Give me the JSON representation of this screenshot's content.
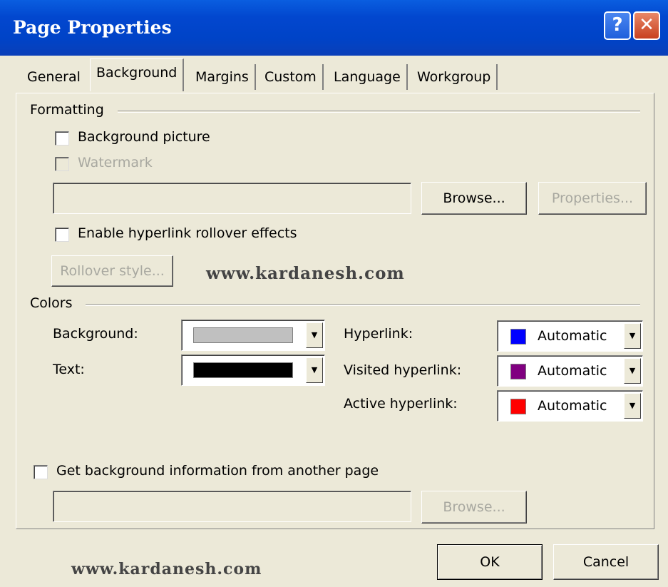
{
  "title": "Page Properties",
  "window_buttons": {
    "help": "?",
    "close": "✕"
  },
  "tabs": [
    "General",
    "Background",
    "Margins",
    "Custom",
    "Language",
    "Workgroup"
  ],
  "formatting": {
    "label": "Formatting",
    "background_picture": "Background picture",
    "watermark": "Watermark",
    "browse": "Browse...",
    "properties": "Properties...",
    "rollover_effects": "Enable hyperlink rollover effects",
    "rollover_style": "Rollover style..."
  },
  "colors": {
    "label": "Colors",
    "background_label": "Background:",
    "text_label": "Text:",
    "hyperlink_label": "Hyperlink:",
    "visited_label": "Visited hyperlink:",
    "active_label": "Active hyperlink:",
    "hyperlink_value": "Automatic",
    "visited_value": "Automatic",
    "active_value": "Automatic",
    "background_color": "#c0c0c0",
    "text_color": "#000000",
    "hyperlink_color": "#0000ff",
    "visited_color": "#800080",
    "active_color": "#ff0000"
  },
  "get_background": {
    "label": "Get background information from another page",
    "browse": "Browse..."
  },
  "watermark_text": "www.kardanesh.com",
  "footer": {
    "ok": "OK",
    "cancel": "Cancel"
  }
}
